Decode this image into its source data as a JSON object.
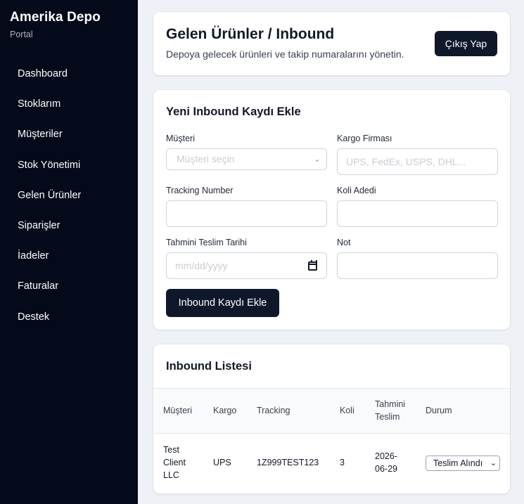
{
  "sidebar": {
    "brand": "Amerika Depo",
    "subtitle": "Portal",
    "items": [
      {
        "label": "Dashboard"
      },
      {
        "label": "Stoklarım"
      },
      {
        "label": "Müşteriler"
      },
      {
        "label": "Stok Yönetimi"
      },
      {
        "label": "Gelen Ürünler"
      },
      {
        "label": "Siparişler"
      },
      {
        "label": "İadeler"
      },
      {
        "label": "Faturalar"
      },
      {
        "label": "Destek"
      }
    ]
  },
  "header": {
    "title": "Gelen Ürünler / Inbound",
    "subtitle": "Depoya gelecek ürünleri ve takip numaralarını yönetin.",
    "logout_label": "Çıkış Yap"
  },
  "form": {
    "title": "Yeni Inbound Kaydı Ekle",
    "customer_label": "Müşteri",
    "customer_placeholder": "Müşteri seçin",
    "carrier_label": "Kargo Firması",
    "carrier_placeholder": "UPS, FedEx, USPS, DHL...",
    "tracking_label": "Tracking Number",
    "tracking_value": "",
    "boxes_label": "Koli Adedi",
    "boxes_value": "",
    "eta_label": "Tahmini Teslim Tarihi",
    "eta_placeholder": "mm/dd/yyyy",
    "note_label": "Not",
    "note_value": "",
    "submit_label": "Inbound Kaydı Ekle"
  },
  "list": {
    "title": "Inbound Listesi",
    "columns": {
      "customer": "Müşteri",
      "carrier": "Kargo",
      "tracking": "Tracking",
      "boxes": "Koli",
      "eta_line1": "Tahmini",
      "eta_line2": "Teslim",
      "status": "Durum"
    },
    "rows": [
      {
        "customer_line1": "Test",
        "customer_line2": "Client",
        "customer_line3": "LLC",
        "carrier": "UPS",
        "tracking": "1Z999TEST123",
        "boxes": "3",
        "eta_line1": "2026-",
        "eta_line2": "06-29",
        "status": "Teslim Alındı"
      }
    ]
  },
  "icons": {
    "select_chevron": "chevron-down-icon",
    "date_picker": "calendar-icon"
  },
  "colors": {
    "sidebar_bg": "#050a1a",
    "primary_button": "#0f172a",
    "page_bg": "#eef1f6"
  }
}
